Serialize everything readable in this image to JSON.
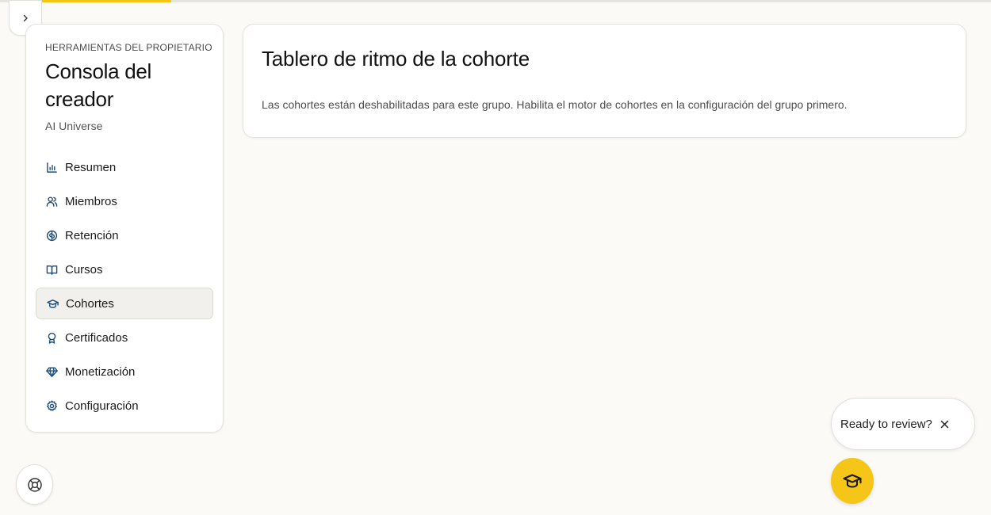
{
  "colors": {
    "accent": "#f5c518",
    "icon": "#1f4f78",
    "background": "#fbfaf7"
  },
  "sidebar": {
    "eyebrow": "HERRAMIENTAS DEL PROPIETARIO",
    "title": "Consola del creador",
    "group": "AI Universe",
    "items": [
      {
        "label": "Resumen",
        "icon": "bar-chart-icon"
      },
      {
        "label": "Miembros",
        "icon": "users-icon"
      },
      {
        "label": "Retención",
        "icon": "brain-icon"
      },
      {
        "label": "Cursos",
        "icon": "book-open-icon"
      },
      {
        "label": "Cohortes",
        "icon": "graduation-cap-icon",
        "active": true
      },
      {
        "label": "Certificados",
        "icon": "award-icon"
      },
      {
        "label": "Monetización",
        "icon": "gem-icon"
      },
      {
        "label": "Configuración",
        "icon": "gear-icon"
      }
    ]
  },
  "main": {
    "title": "Tablero de ritmo de la cohorte",
    "message": "Las cohortes están deshabilitadas para este grupo. Habilita el motor de cohortes en la configuración del grupo primero."
  },
  "review": {
    "label": "Ready to review?"
  }
}
